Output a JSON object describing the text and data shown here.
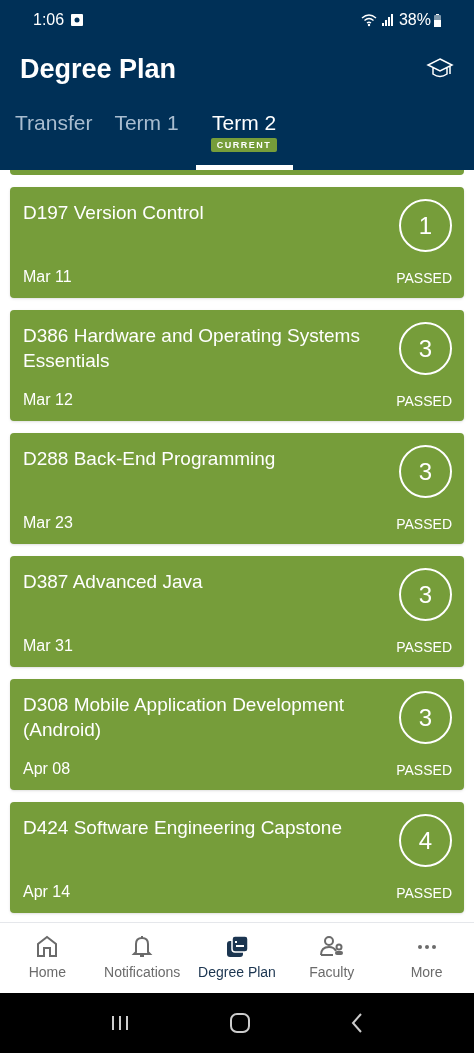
{
  "status_bar": {
    "time": "1:06",
    "battery": "38%"
  },
  "header": {
    "title": "Degree Plan"
  },
  "tabs": [
    {
      "label": "Transfer",
      "selected": false
    },
    {
      "label": "Term 1",
      "selected": false
    },
    {
      "label": "Term 2",
      "selected": true,
      "badge": "CURRENT"
    }
  ],
  "courses": [
    {
      "title": "D197 Version Control",
      "units": "1",
      "date": "Mar 11",
      "status": "PASSED"
    },
    {
      "title": "D386 Hardware and Operating Systems Essentials",
      "units": "3",
      "date": "Mar 12",
      "status": "PASSED"
    },
    {
      "title": "D288 Back-End Programming",
      "units": "3",
      "date": "Mar 23",
      "status": "PASSED"
    },
    {
      "title": "D387 Advanced Java",
      "units": "3",
      "date": "Mar 31",
      "status": "PASSED"
    },
    {
      "title": "D308 Mobile Application Development (Android)",
      "units": "3",
      "date": "Apr 08",
      "status": "PASSED"
    },
    {
      "title": "D424 Software Engineering Capstone",
      "units": "4",
      "date": "Apr 14",
      "status": "PASSED"
    }
  ],
  "bottom_nav": [
    {
      "label": "Home",
      "selected": false
    },
    {
      "label": "Notifications",
      "selected": false
    },
    {
      "label": "Degree Plan",
      "selected": true
    },
    {
      "label": "Faculty",
      "selected": false
    },
    {
      "label": "More",
      "selected": false
    }
  ]
}
